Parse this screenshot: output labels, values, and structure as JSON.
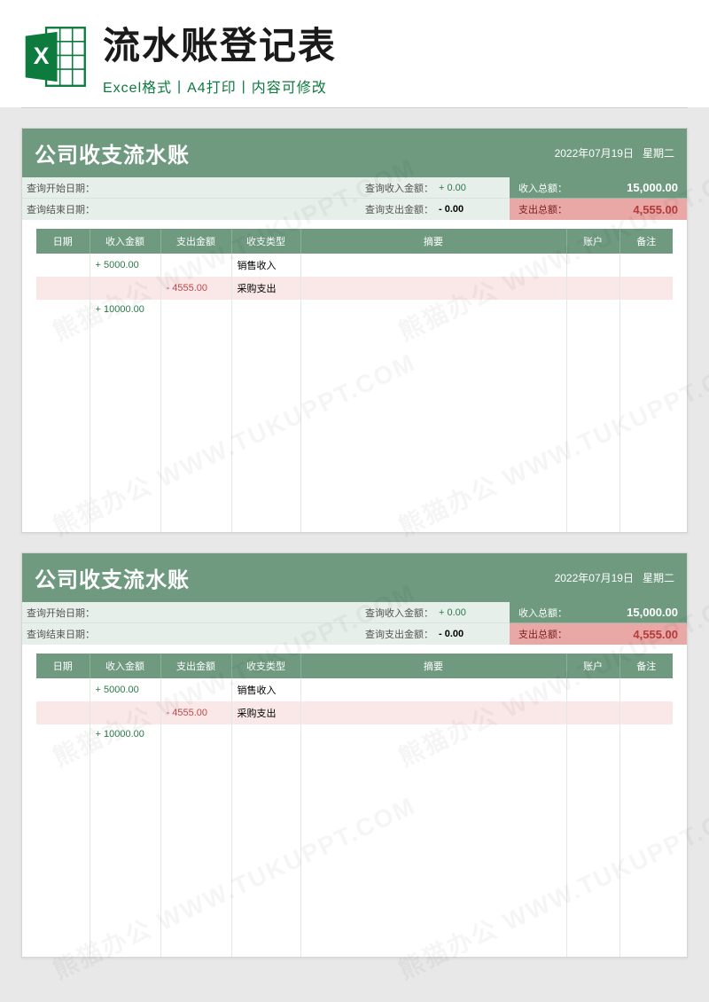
{
  "header": {
    "main_title": "流水账登记表",
    "sub_title": "Excel格式丨A4打印丨内容可修改"
  },
  "sheet": {
    "title": "公司收支流水账",
    "date": "2022年07月19日",
    "weekday": "星期二",
    "summary": {
      "start_date_lbl": "查询开始日期：",
      "end_date_lbl": "查询结束日期：",
      "income_query_lbl": "查询收入金额：",
      "income_query_val": "+ 0.00",
      "expense_query_lbl": "查询支出金额：",
      "expense_query_val": "- 0.00",
      "income_total_lbl": "收入总额：",
      "income_total_val": "15,000.00",
      "expense_total_lbl": "支出总额：",
      "expense_total_val": "4,555.00"
    },
    "columns": {
      "date": "日期",
      "income": "收入金额",
      "expense": "支出金额",
      "type": "收支类型",
      "summary": "摘要",
      "account": "账户",
      "note": "备注"
    },
    "rows": [
      {
        "income": "+ 5000.00",
        "expense": "",
        "type": "销售收入",
        "cls": ""
      },
      {
        "income": "",
        "expense": "- 4555.00",
        "type": "采购支出",
        "cls": "row-out"
      },
      {
        "income": "+ 10000.00",
        "expense": "",
        "type": "",
        "cls": ""
      }
    ]
  },
  "watermark": "熊猫办公 WWW.TUKUPPT.COM"
}
